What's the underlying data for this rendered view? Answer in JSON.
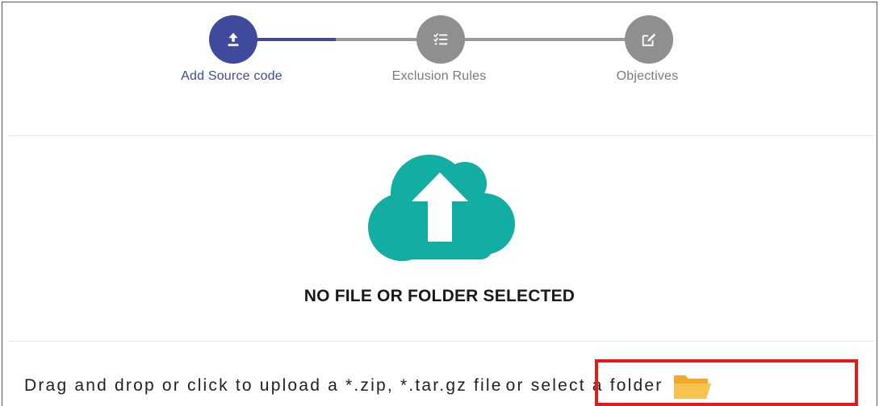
{
  "stepper": {
    "steps": [
      {
        "label": "Add Source code",
        "icon": "upload-icon",
        "state": "active"
      },
      {
        "label": "Exclusion Rules",
        "icon": "checklist-icon",
        "state": "inactive"
      },
      {
        "label": "Objectives",
        "icon": "edit-icon",
        "state": "inactive"
      }
    ],
    "colors": {
      "active": "#3f4a9c",
      "inactive": "#8f8f8f"
    }
  },
  "dropzone": {
    "icon": "cloud-upload-icon",
    "icon_color": "#12ada3",
    "status": "NO FILE OR FOLDER SELECTED"
  },
  "upload": {
    "instruction": "Drag and drop or click to upload a *.zip, *.tar.gz file",
    "folder_link": "or select a folder",
    "folder_icon": "folder-open-icon",
    "folder_icon_color": "#f4b63f",
    "highlight_color": "#e31b1b"
  }
}
